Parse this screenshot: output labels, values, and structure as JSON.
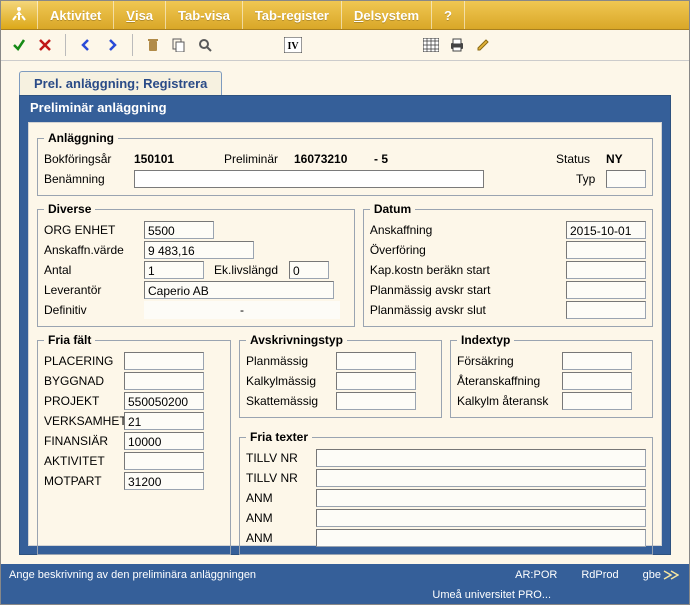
{
  "menubar": {
    "items": [
      {
        "label": "Aktivitet",
        "mn": -1
      },
      {
        "label": "Visa",
        "mn": 0
      },
      {
        "label": "Tab-visa",
        "mn": -1
      },
      {
        "label": "Tab-register",
        "mn": -1
      },
      {
        "label": "Delsystem",
        "mn": 0
      },
      {
        "label": "?",
        "mn": -1
      }
    ]
  },
  "tab": {
    "title": "Prel. anläggning; Registrera"
  },
  "panel": {
    "title": "Preliminär anläggning"
  },
  "anlaggning": {
    "legend": "Anläggning",
    "bokforingsar_lbl": "Bokföringsår",
    "bokforingsar": "150101",
    "preliminar_lbl": "Preliminär",
    "preliminar": "16073210",
    "preliminar_suffix": "- 5",
    "status_lbl": "Status",
    "status": "NY",
    "benamning_lbl": "Benämning",
    "benamning": "",
    "typ_lbl": "Typ",
    "typ": ""
  },
  "diverse": {
    "legend": "Diverse",
    "org_enhet_lbl": "ORG ENHET",
    "org_enhet": "5500",
    "anskaffn_varde_lbl": "Anskaffn.värde",
    "anskaffn_varde": "9 483,16",
    "antal_lbl": "Antal",
    "antal": "1",
    "ek_livslangd_lbl": "Ek.livslängd",
    "ek_livslangd": "0",
    "leverantor_lbl": "Leverantör",
    "leverantor": "Caperio AB",
    "definitiv_lbl": "Definitiv",
    "definitiv": "-"
  },
  "datum": {
    "legend": "Datum",
    "anskaffning_lbl": "Anskaffning",
    "anskaffning": "2015-10-01",
    "overforing_lbl": "Överföring",
    "overforing": "",
    "kap_start_lbl": "Kap.kostn beräkn start",
    "kap_start": "",
    "plan_start_lbl": "Planmässig avskr start",
    "plan_start": "",
    "plan_slut_lbl": "Planmässig avskr slut",
    "plan_slut": ""
  },
  "friafalt": {
    "legend": "Fria fält",
    "items": [
      {
        "label": "PLACERING",
        "value": ""
      },
      {
        "label": "BYGGNAD",
        "value": ""
      },
      {
        "label": "PROJEKT",
        "value": "550050200"
      },
      {
        "label": "VERKSAMHET",
        "value": "21"
      },
      {
        "label": "FINANSIÄR",
        "value": "10000"
      },
      {
        "label": "AKTIVITET",
        "value": ""
      },
      {
        "label": "MOTPART",
        "value": "31200"
      }
    ]
  },
  "avskrivningstyp": {
    "legend": "Avskrivningstyp",
    "items": [
      {
        "label": "Planmässig",
        "value": ""
      },
      {
        "label": "Kalkylmässig",
        "value": ""
      },
      {
        "label": "Skattemässig",
        "value": ""
      }
    ]
  },
  "indextyp": {
    "legend": "Indextyp",
    "items": [
      {
        "label": "Försäkring",
        "value": ""
      },
      {
        "label": "Återanskaffning",
        "value": ""
      },
      {
        "label": "Kalkylm återansk",
        "value": ""
      }
    ]
  },
  "friatexter": {
    "legend": "Fria texter",
    "items": [
      {
        "label": "TILLV NR",
        "value": ""
      },
      {
        "label": "TILLV NR",
        "value": ""
      },
      {
        "label": "ANM",
        "value": ""
      },
      {
        "label": "ANM",
        "value": ""
      },
      {
        "label": "ANM",
        "value": ""
      }
    ]
  },
  "status_bar": {
    "message": "Ange beskrivning av den preliminära anläggningen",
    "slot1": "AR:POR",
    "slot2": "RdProd",
    "slot3": "gbe",
    "slot4": "Umeå universitet PRO..."
  }
}
